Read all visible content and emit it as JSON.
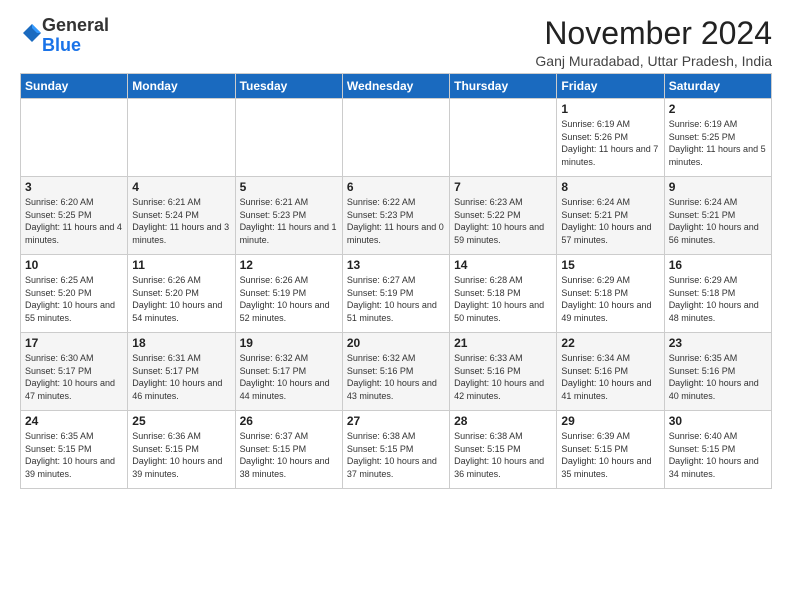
{
  "logo": {
    "general": "General",
    "blue": "Blue"
  },
  "header": {
    "month": "November 2024",
    "location": "Ganj Muradabad, Uttar Pradesh, India"
  },
  "weekdays": [
    "Sunday",
    "Monday",
    "Tuesday",
    "Wednesday",
    "Thursday",
    "Friday",
    "Saturday"
  ],
  "weeks": [
    [
      {
        "day": "",
        "info": ""
      },
      {
        "day": "",
        "info": ""
      },
      {
        "day": "",
        "info": ""
      },
      {
        "day": "",
        "info": ""
      },
      {
        "day": "",
        "info": ""
      },
      {
        "day": "1",
        "info": "Sunrise: 6:19 AM\nSunset: 5:26 PM\nDaylight: 11 hours and 7 minutes."
      },
      {
        "day": "2",
        "info": "Sunrise: 6:19 AM\nSunset: 5:25 PM\nDaylight: 11 hours and 5 minutes."
      }
    ],
    [
      {
        "day": "3",
        "info": "Sunrise: 6:20 AM\nSunset: 5:25 PM\nDaylight: 11 hours and 4 minutes."
      },
      {
        "day": "4",
        "info": "Sunrise: 6:21 AM\nSunset: 5:24 PM\nDaylight: 11 hours and 3 minutes."
      },
      {
        "day": "5",
        "info": "Sunrise: 6:21 AM\nSunset: 5:23 PM\nDaylight: 11 hours and 1 minute."
      },
      {
        "day": "6",
        "info": "Sunrise: 6:22 AM\nSunset: 5:23 PM\nDaylight: 11 hours and 0 minutes."
      },
      {
        "day": "7",
        "info": "Sunrise: 6:23 AM\nSunset: 5:22 PM\nDaylight: 10 hours and 59 minutes."
      },
      {
        "day": "8",
        "info": "Sunrise: 6:24 AM\nSunset: 5:21 PM\nDaylight: 10 hours and 57 minutes."
      },
      {
        "day": "9",
        "info": "Sunrise: 6:24 AM\nSunset: 5:21 PM\nDaylight: 10 hours and 56 minutes."
      }
    ],
    [
      {
        "day": "10",
        "info": "Sunrise: 6:25 AM\nSunset: 5:20 PM\nDaylight: 10 hours and 55 minutes."
      },
      {
        "day": "11",
        "info": "Sunrise: 6:26 AM\nSunset: 5:20 PM\nDaylight: 10 hours and 54 minutes."
      },
      {
        "day": "12",
        "info": "Sunrise: 6:26 AM\nSunset: 5:19 PM\nDaylight: 10 hours and 52 minutes."
      },
      {
        "day": "13",
        "info": "Sunrise: 6:27 AM\nSunset: 5:19 PM\nDaylight: 10 hours and 51 minutes."
      },
      {
        "day": "14",
        "info": "Sunrise: 6:28 AM\nSunset: 5:18 PM\nDaylight: 10 hours and 50 minutes."
      },
      {
        "day": "15",
        "info": "Sunrise: 6:29 AM\nSunset: 5:18 PM\nDaylight: 10 hours and 49 minutes."
      },
      {
        "day": "16",
        "info": "Sunrise: 6:29 AM\nSunset: 5:18 PM\nDaylight: 10 hours and 48 minutes."
      }
    ],
    [
      {
        "day": "17",
        "info": "Sunrise: 6:30 AM\nSunset: 5:17 PM\nDaylight: 10 hours and 47 minutes."
      },
      {
        "day": "18",
        "info": "Sunrise: 6:31 AM\nSunset: 5:17 PM\nDaylight: 10 hours and 46 minutes."
      },
      {
        "day": "19",
        "info": "Sunrise: 6:32 AM\nSunset: 5:17 PM\nDaylight: 10 hours and 44 minutes."
      },
      {
        "day": "20",
        "info": "Sunrise: 6:32 AM\nSunset: 5:16 PM\nDaylight: 10 hours and 43 minutes."
      },
      {
        "day": "21",
        "info": "Sunrise: 6:33 AM\nSunset: 5:16 PM\nDaylight: 10 hours and 42 minutes."
      },
      {
        "day": "22",
        "info": "Sunrise: 6:34 AM\nSunset: 5:16 PM\nDaylight: 10 hours and 41 minutes."
      },
      {
        "day": "23",
        "info": "Sunrise: 6:35 AM\nSunset: 5:16 PM\nDaylight: 10 hours and 40 minutes."
      }
    ],
    [
      {
        "day": "24",
        "info": "Sunrise: 6:35 AM\nSunset: 5:15 PM\nDaylight: 10 hours and 39 minutes."
      },
      {
        "day": "25",
        "info": "Sunrise: 6:36 AM\nSunset: 5:15 PM\nDaylight: 10 hours and 39 minutes."
      },
      {
        "day": "26",
        "info": "Sunrise: 6:37 AM\nSunset: 5:15 PM\nDaylight: 10 hours and 38 minutes."
      },
      {
        "day": "27",
        "info": "Sunrise: 6:38 AM\nSunset: 5:15 PM\nDaylight: 10 hours and 37 minutes."
      },
      {
        "day": "28",
        "info": "Sunrise: 6:38 AM\nSunset: 5:15 PM\nDaylight: 10 hours and 36 minutes."
      },
      {
        "day": "29",
        "info": "Sunrise: 6:39 AM\nSunset: 5:15 PM\nDaylight: 10 hours and 35 minutes."
      },
      {
        "day": "30",
        "info": "Sunrise: 6:40 AM\nSunset: 5:15 PM\nDaylight: 10 hours and 34 minutes."
      }
    ]
  ]
}
